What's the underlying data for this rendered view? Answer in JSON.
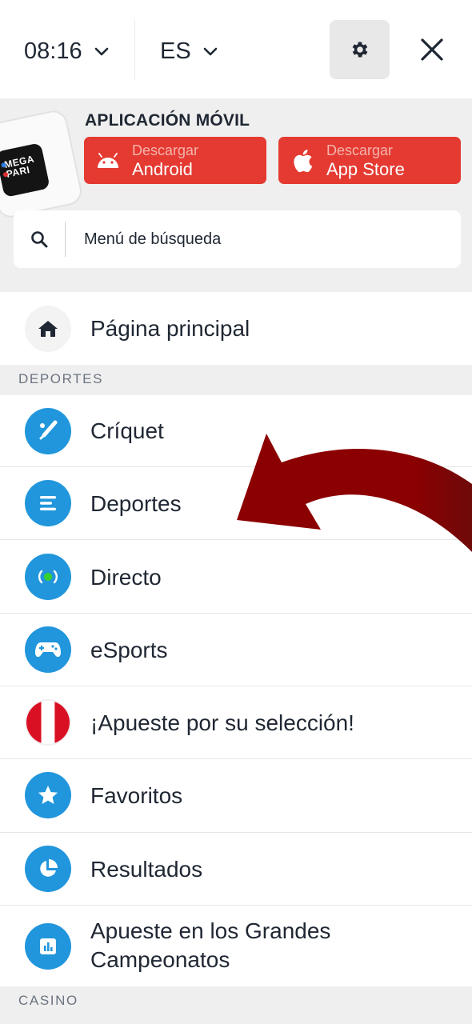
{
  "header": {
    "time": "08:16",
    "language": "ES"
  },
  "app_banner": {
    "title": "APLICACIÓN MÓVIL",
    "logo_text_top": "MEGA",
    "logo_text_bottom": "PARI",
    "android": {
      "line1": "Descargar",
      "line2": "Android"
    },
    "appstore": {
      "line1": "Descargar",
      "line2": "App Store"
    }
  },
  "search": {
    "placeholder": "Menú de búsqueda"
  },
  "menu": {
    "home": {
      "label": "Página principal",
      "icon": "home-icon"
    },
    "sections": {
      "sports": "DEPORTES",
      "casino": "CASINO"
    },
    "items": [
      {
        "label": "Críquet",
        "icon": "cricket-icon"
      },
      {
        "label": "Deportes",
        "icon": "sports-list-icon"
      },
      {
        "label": "Directo",
        "icon": "live-icon"
      },
      {
        "label": "eSports",
        "icon": "gamepad-icon"
      },
      {
        "label": "¡Apueste por su selección!",
        "icon": "peru-flag-icon"
      },
      {
        "label": "Favoritos",
        "icon": "star-icon"
      },
      {
        "label": "Resultados",
        "icon": "pie-chart-icon"
      },
      {
        "label": "Apueste en los Grandes Campeonatos",
        "icon": "bar-chart-icon"
      }
    ]
  },
  "colors": {
    "accent_blue": "#2196dc",
    "download_red": "#e43a31",
    "arrow_red": "#8b0000",
    "live_green": "#37d12d"
  }
}
